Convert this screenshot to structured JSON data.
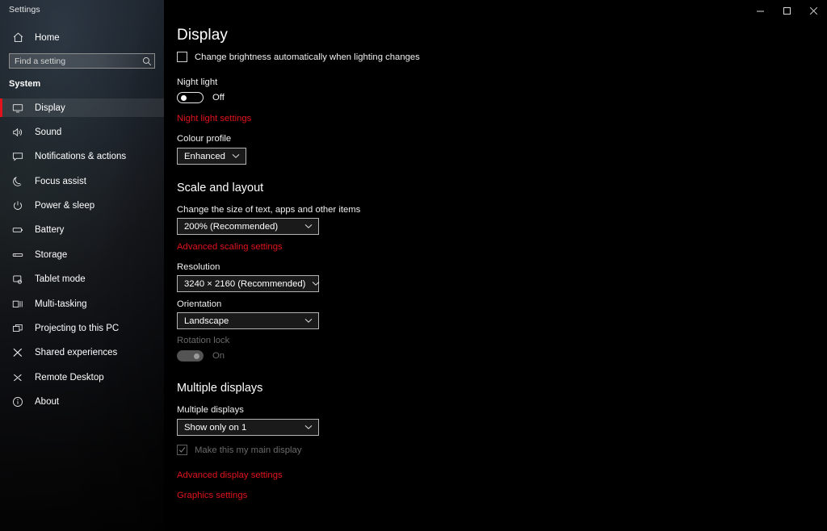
{
  "window": {
    "caption": "Settings",
    "controls": [
      {
        "name": "minimize-button",
        "label": "Minimize"
      },
      {
        "name": "maximize-button",
        "label": "Restore"
      },
      {
        "name": "close-button",
        "label": "Close"
      }
    ]
  },
  "sidebar": {
    "home_label": "Home",
    "home_icon": "home-icon",
    "search": {
      "placeholder": "Find a setting",
      "value": "",
      "icon": "search-icon"
    },
    "section_title": "System",
    "items": [
      {
        "label": "Display",
        "icon": "monitor-icon",
        "selected": true
      },
      {
        "label": "Sound",
        "icon": "speaker-icon",
        "selected": false
      },
      {
        "label": "Notifications & actions",
        "icon": "notification-icon",
        "selected": false
      },
      {
        "label": "Focus assist",
        "icon": "moon-icon",
        "selected": false
      },
      {
        "label": "Power & sleep",
        "icon": "power-icon",
        "selected": false
      },
      {
        "label": "Battery",
        "icon": "battery-icon",
        "selected": false
      },
      {
        "label": "Storage",
        "icon": "storage-icon",
        "selected": false
      },
      {
        "label": "Tablet mode",
        "icon": "tablet-icon",
        "selected": false
      },
      {
        "label": "Multi-tasking",
        "icon": "multitasking-icon",
        "selected": false
      },
      {
        "label": "Projecting to this PC",
        "icon": "projecting-icon",
        "selected": false
      },
      {
        "label": "Shared experiences",
        "icon": "share-icon",
        "selected": false
      },
      {
        "label": "Remote Desktop",
        "icon": "remote-desktop-icon",
        "selected": false
      },
      {
        "label": "About",
        "icon": "info-icon",
        "selected": false
      }
    ]
  },
  "main": {
    "page_title": "Display",
    "auto_brightness": {
      "label": "Change brightness automatically when lighting changes",
      "checked": false,
      "disabled": false
    },
    "night_light": {
      "label": "Night light",
      "state": "Off",
      "on": false,
      "settings_link": "Night light settings"
    },
    "colour_profile": {
      "label": "Colour profile",
      "value": "Enhanced"
    },
    "scale_and_layout": {
      "heading": "Scale and layout",
      "scale": {
        "label": "Change the size of text, apps and other items",
        "value": "200% (Recommended)"
      },
      "advanced_scaling_link": "Advanced scaling settings",
      "resolution": {
        "label": "Resolution",
        "value": "3240 × 2160 (Recommended)"
      },
      "orientation": {
        "label": "Orientation",
        "value": "Landscape"
      },
      "rotation_lock": {
        "label": "Rotation lock",
        "state": "On",
        "on": true,
        "disabled": true
      }
    },
    "multiple_displays": {
      "heading": "Multiple displays",
      "select": {
        "label": "Multiple displays",
        "value": "Show only on 1"
      },
      "main_display": {
        "label": "Make this my main display",
        "checked": true,
        "disabled": true
      },
      "advanced_display_link": "Advanced display settings",
      "graphics_link": "Graphics settings"
    }
  },
  "colors": {
    "accent": "#e2131d",
    "content_bg": "#000000",
    "text": "#ffffff",
    "disabled_text": "#6a6a6a"
  }
}
